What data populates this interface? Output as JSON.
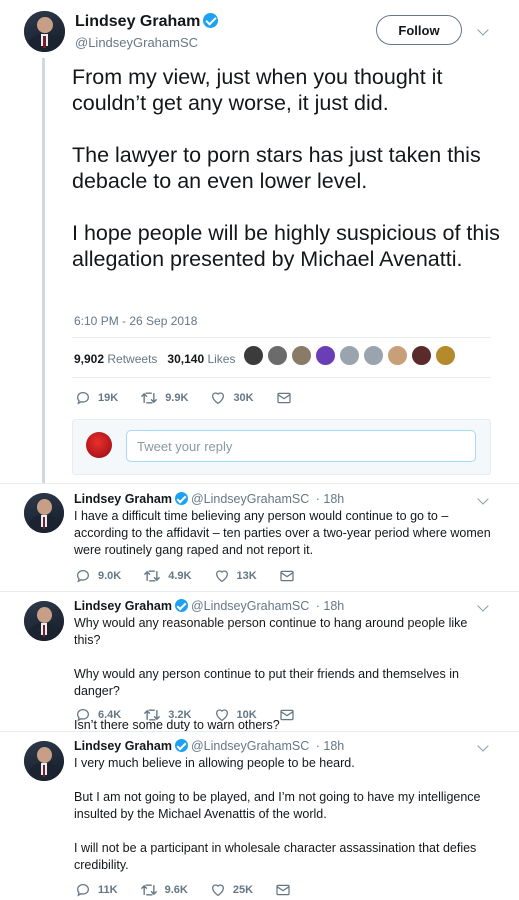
{
  "main_tweet": {
    "author_name": "Lindsey Graham",
    "author_handle": "@LindseyGrahamSC",
    "follow_label": "Follow",
    "paragraphs": [
      "From my view, just when you thought it couldn’t get any worse, it just did.",
      "The lawyer to porn stars has just taken this debacle to an even lower level.",
      "I hope people will be highly suspicious of this allegation presented by Michael Avenatti."
    ],
    "timestamp": "6:10 PM - 26 Sep 2018",
    "retweets_count": "9,902",
    "retweets_label": "Retweets",
    "likes_count": "30,140",
    "likes_label": "Likes",
    "likers": [
      "#3b3b3b",
      "#6b6b6b",
      "#8a7a68",
      "#6a3fb5",
      "#9aa4ae",
      "#9aa4ae",
      "#c7a07a",
      "#5b2a2a",
      "#b58a2c"
    ],
    "reply_count": "19K",
    "retweet_count_short": "9.9K",
    "like_count_short": "30K"
  },
  "reply_box": {
    "placeholder": "Tweet your reply"
  },
  "replies": [
    {
      "name": "Lindsey Graham",
      "handle": "@LindseyGrahamSC",
      "time": "· 18h",
      "paragraphs": [
        "I have a difficult time believing any person would continue to go to – according to the affidavit – ten parties over a two-year period where women were routinely gang raped and not report it."
      ],
      "reply_count": "9.0K",
      "retweet_count": "4.9K",
      "like_count": "13K"
    },
    {
      "name": "Lindsey Graham",
      "handle": "@LindseyGrahamSC",
      "time": "· 18h",
      "paragraphs": [
        "Why would any reasonable person continue to hang around people like this?",
        "Why would any person continue to put their friends and themselves in danger?",
        "Isn’t there some duty to warn others?"
      ],
      "reply_count": "6.4K",
      "retweet_count": "3.2K",
      "like_count": "10K"
    },
    {
      "name": "Lindsey Graham",
      "handle": "@LindseyGrahamSC",
      "time": "· 18h",
      "paragraphs": [
        "I very much believe in allowing people to be heard.",
        "But I am not going to be played, and I’m not going to have my intelligence insulted by the Michael Avenattis of the world.",
        "I will not be a participant in wholesale character assassination that defies credibility."
      ],
      "reply_count": "11K",
      "retweet_count": "9.6K",
      "like_count": "25K"
    }
  ],
  "colors": {
    "verified": "#1da1f2",
    "muted_text": "#657786",
    "divider": "#e6ecf0"
  }
}
